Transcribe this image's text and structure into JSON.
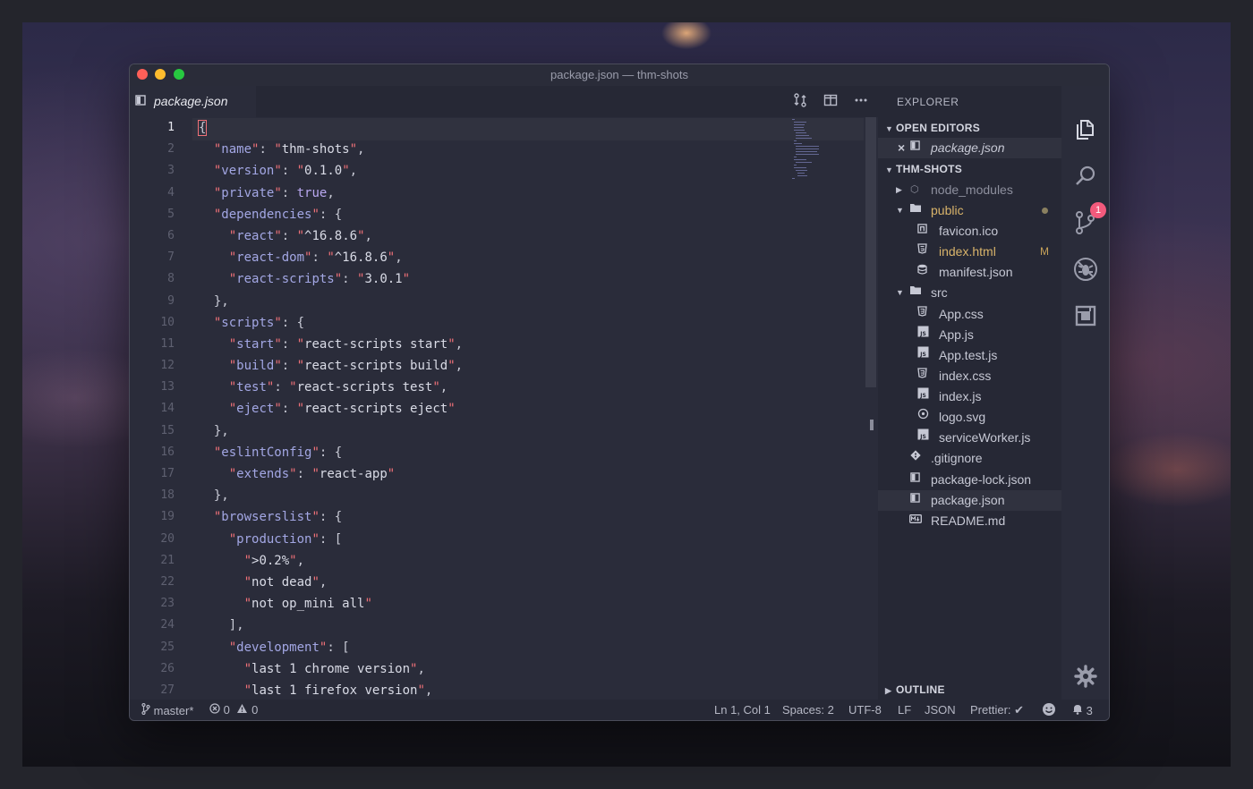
{
  "window": {
    "title": "package.json — thm-shots"
  },
  "tab": {
    "label": "package.json"
  },
  "editor": {
    "line_numbers": [
      "1",
      "2",
      "3",
      "4",
      "5",
      "6",
      "7",
      "8",
      "9",
      "10",
      "11",
      "12",
      "13",
      "14",
      "15",
      "16",
      "17",
      "18",
      "19",
      "20",
      "21",
      "22",
      "23",
      "24",
      "25",
      "26",
      "27"
    ],
    "code": {
      "l2_key": "name",
      "l2_val": "thm-shots",
      "l3_key": "version",
      "l3_val": "0.1.0",
      "l4_key": "private",
      "l4_val": "true",
      "l5_key": "dependencies",
      "l6_key": "react",
      "l6_val": "^16.8.6",
      "l7_key": "react-dom",
      "l7_val": "^16.8.6",
      "l8_key": "react-scripts",
      "l8_val": "3.0.1",
      "l10_key": "scripts",
      "l11_key": "start",
      "l11_val": "react-scripts start",
      "l12_key": "build",
      "l12_val": "react-scripts build",
      "l13_key": "test",
      "l13_val": "react-scripts test",
      "l14_key": "eject",
      "l14_val": "react-scripts eject",
      "l16_key": "eslintConfig",
      "l17_key": "extends",
      "l17_val": "react-app",
      "l19_key": "browserslist",
      "l20_key": "production",
      "l21_val": ">0.2%",
      "l22_val": "not dead",
      "l23_val": "not op_mini all",
      "l25_key": "development",
      "l26_val": "last 1 chrome version",
      "l27_val": "last 1 firefox version"
    }
  },
  "sidebar": {
    "title": "EXPLORER",
    "open_editors": "OPEN EDITORS",
    "open_file": "package.json",
    "project": "THM-SHOTS",
    "tree": {
      "node_modules": "node_modules",
      "public": "public",
      "favicon": "favicon.ico",
      "index_html": "index.html",
      "index_html_badge": "M",
      "manifest": "manifest.json",
      "src": "src",
      "app_css": "App.css",
      "app_js": "App.js",
      "app_test": "App.test.js",
      "index_css": "index.css",
      "index_js": "index.js",
      "logo": "logo.svg",
      "sw": "serviceWorker.js",
      "gitignore": ".gitignore",
      "lock": "package-lock.json",
      "package": "package.json",
      "readme": "README.md"
    },
    "outline": "OUTLINE"
  },
  "activity": {
    "scm_badge": "1"
  },
  "status": {
    "branch": "master*",
    "errors": "0",
    "warnings": "0",
    "position": "Ln 1, Col 1",
    "spaces": "Spaces: 2",
    "encoding": "UTF-8",
    "eol": "LF",
    "language": "JSON",
    "prettier": "Prettier: ✔",
    "notifications": "3"
  },
  "icons": {
    "close": "×",
    "tab_file": "◧",
    "chevron": "▸",
    "chevron_open": "▾"
  }
}
